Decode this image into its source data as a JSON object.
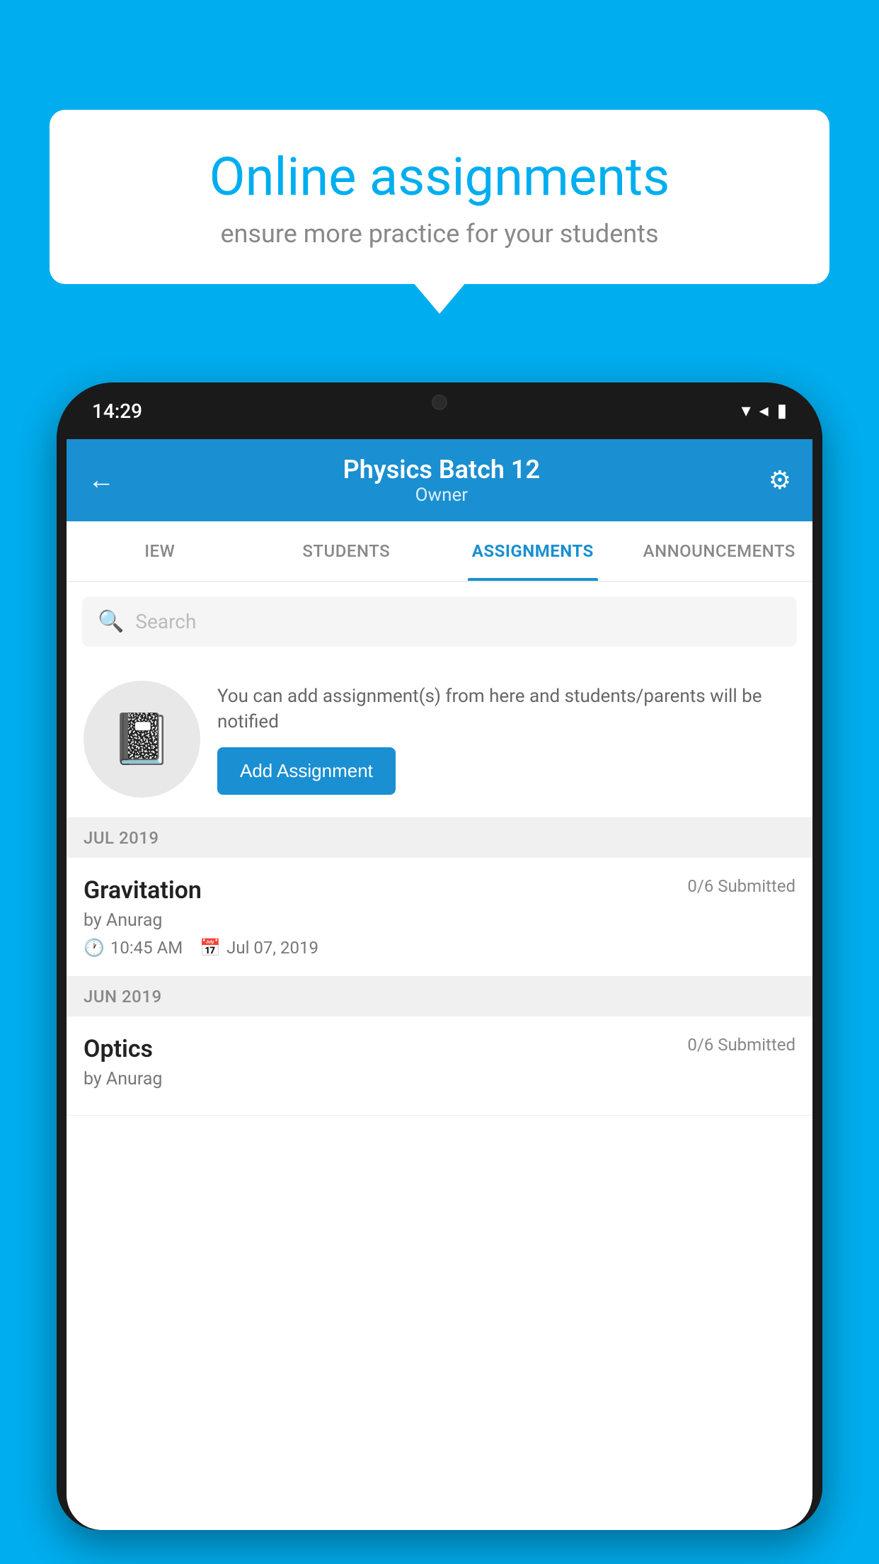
{
  "background_color": "#00AEEF",
  "speech_bubble": {
    "title": "Online assignments",
    "subtitle": "ensure more practice for your students"
  },
  "phone": {
    "status_bar": {
      "time": "14:29",
      "icons": [
        "▾",
        "◂",
        "▮"
      ]
    },
    "header": {
      "title": "Physics Batch 12",
      "subtitle": "Owner",
      "back_label": "←",
      "gear_label": "⚙"
    },
    "tabs": [
      {
        "label": "IEW",
        "active": false
      },
      {
        "label": "STUDENTS",
        "active": false
      },
      {
        "label": "ASSIGNMENTS",
        "active": true
      },
      {
        "label": "ANNOUNCEMENTS",
        "active": false
      }
    ],
    "search": {
      "placeholder": "Search"
    },
    "promo": {
      "description": "You can add assignment(s) from here and students/parents will be notified",
      "button_label": "Add Assignment"
    },
    "sections": [
      {
        "month": "JUL 2019",
        "assignments": [
          {
            "title": "Gravitation",
            "submitted": "0/6 Submitted",
            "author": "by Anurag",
            "time": "10:45 AM",
            "date": "Jul 07, 2019"
          }
        ]
      },
      {
        "month": "JUN 2019",
        "assignments": [
          {
            "title": "Optics",
            "submitted": "0/6 Submitted",
            "author": "by Anurag",
            "time": "",
            "date": ""
          }
        ]
      }
    ]
  }
}
